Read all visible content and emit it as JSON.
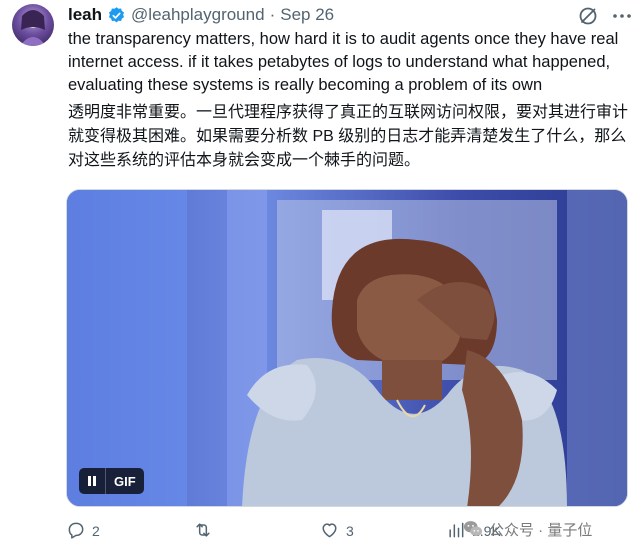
{
  "author": {
    "display_name": "leah",
    "handle": "@leahplayground",
    "separator": "·",
    "date": "Sep 26"
  },
  "tweet": {
    "text_en": "the transparency matters, how hard it is to audit agents once they have real internet access. if it takes petabytes of logs to understand what happened, evaluating these systems is really becoming a problem of its own",
    "text_zh": "透明度非常重要。一旦代理程序获得了真正的互联网访问权限，要对其进行审计就变得极其困难。如果需要分析数 PB 级别的日志才能弄清楚发生了什么，那么对这些系统的评估本身就会变成一个棘手的问题。"
  },
  "media": {
    "gif_label": "GIF"
  },
  "actions": {
    "replies": "2",
    "reposts": "",
    "likes": "3",
    "views": "1.9K"
  },
  "watermark": {
    "text": "公众号 · 量子位"
  },
  "colors": {
    "text_primary": "#0f1419",
    "text_secondary": "#536471",
    "verified_blue": "#1d9bf0"
  },
  "icons": {
    "verified": "verified-badge-icon",
    "grok": "grok-slash-icon",
    "more": "more-dots-icon",
    "reply": "reply-icon",
    "repost": "repost-icon",
    "like": "heart-icon",
    "views": "views-chart-icon",
    "pause": "pause-icon",
    "wechat": "wechat-icon"
  }
}
